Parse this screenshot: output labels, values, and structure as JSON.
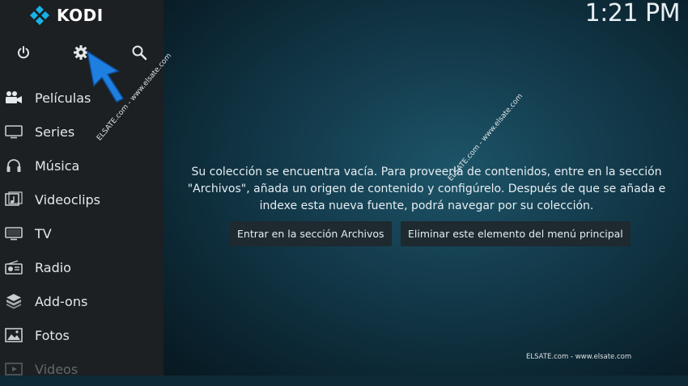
{
  "app": {
    "name": "KODI"
  },
  "clock": "1:21 PM",
  "top_icons": [
    {
      "name": "power-icon"
    },
    {
      "name": "settings-icon"
    },
    {
      "name": "search-icon"
    }
  ],
  "menu": [
    {
      "label": "Películas"
    },
    {
      "label": "Series"
    },
    {
      "label": "Música"
    },
    {
      "label": "Videoclips"
    },
    {
      "label": "TV"
    },
    {
      "label": "Radio"
    },
    {
      "label": "Add-ons"
    },
    {
      "label": "Fotos"
    },
    {
      "label": "Videos"
    }
  ],
  "main": {
    "message_line1": "Su colección se encuentra vacía. Para proveerla de contenidos, entre en la sección",
    "message_line2": "\"Archivos\", añada un origen de contenido y configúrelo. Después de que se añada e",
    "message_line3": "indexe esta nueva fuente, podrá navegar por su colección.",
    "button_files": "Entrar en la sección Archivos",
    "button_remove": "Eliminar este elemento del menú principal"
  },
  "watermark": "ELSATE.com - www.elsate.com",
  "colors": {
    "accent": "#2f8fe0",
    "sidebar": "#1c2023"
  }
}
